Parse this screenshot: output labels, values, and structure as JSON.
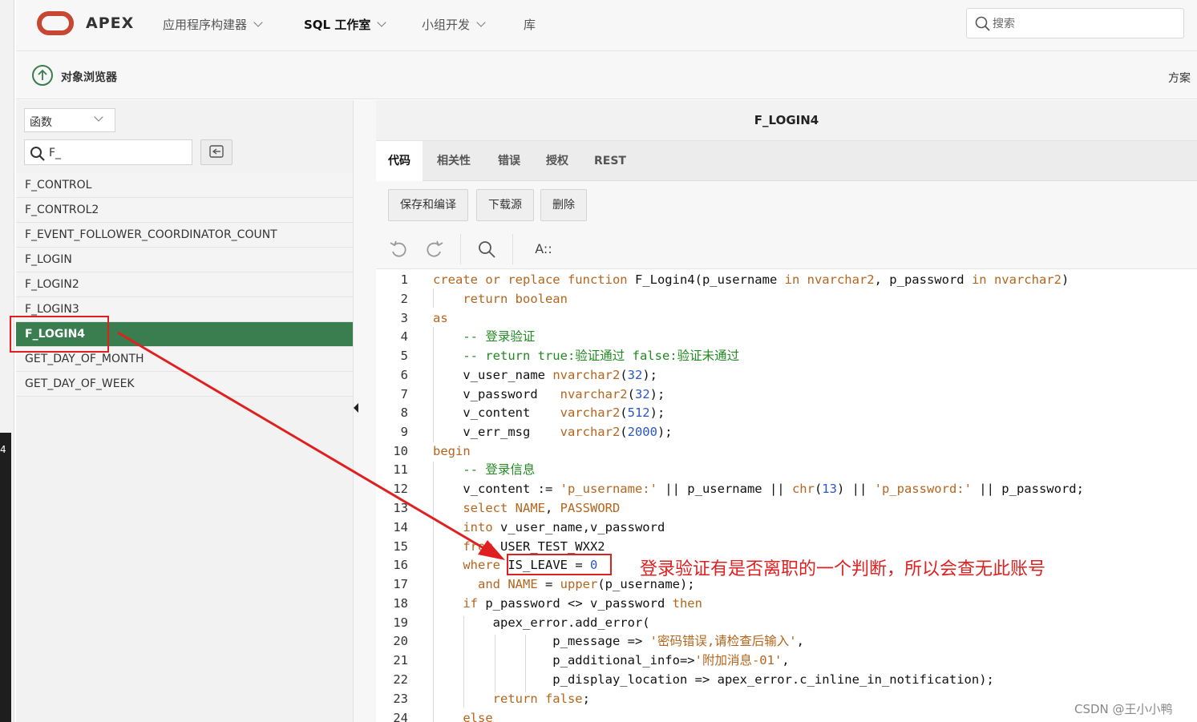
{
  "edge": {
    "marker": "4"
  },
  "topbar": {
    "logo_text": "APEX",
    "nav": [
      {
        "label": "应用程序构建器",
        "has_menu": true
      },
      {
        "label": "SQL 工作室",
        "has_menu": true,
        "active": true
      },
      {
        "label": "小组开发",
        "has_menu": true
      },
      {
        "label": "库",
        "has_menu": false
      }
    ],
    "search_placeholder": "搜索"
  },
  "subheader": {
    "title": "对象浏览器",
    "scheme_label": "方案"
  },
  "left": {
    "object_type": "函数",
    "filter_value": "F_",
    "objects": [
      "F_CONTROL",
      "F_CONTROL2",
      "F_EVENT_FOLLOWER_COORDINATOR_COUNT",
      "F_LOGIN",
      "F_LOGIN2",
      "F_LOGIN3",
      "F_LOGIN4",
      "GET_DAY_OF_MONTH",
      "GET_DAY_OF_WEEK"
    ],
    "selected": "F_LOGIN4"
  },
  "right": {
    "object_name": "F_LOGIN4",
    "tabs": [
      "代码",
      "相关性",
      "错误",
      "授权",
      "REST"
    ],
    "active_tab": "代码",
    "buttons": {
      "save_compile": "保存和编译",
      "download": "下载源",
      "delete": "删除"
    },
    "toolbar": {
      "font_label": "A::"
    }
  },
  "code_lines": [
    "1",
    "2",
    "3",
    "4",
    "5",
    "6",
    "7",
    "8",
    "9",
    "10",
    "11",
    "12",
    "13",
    "14",
    "15",
    "16",
    "17",
    "18",
    "19",
    "20",
    "21",
    "22",
    "23",
    "24"
  ],
  "annotation": {
    "text": "登录验证有是否离职的一个判断，所以会查无此账号"
  },
  "watermark": "CSDN @王小小鸭",
  "colors": {
    "accent_green": "#3a7d4e",
    "oracle_red": "#c74634",
    "annotation_red": "#e02020"
  }
}
